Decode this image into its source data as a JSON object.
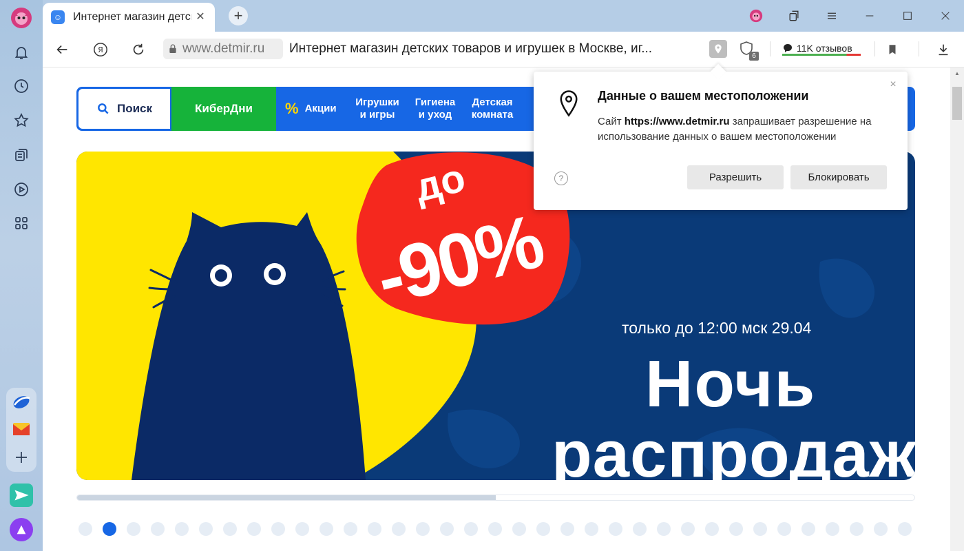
{
  "tab": {
    "title": "Интернет магазин детских товаров и игрушек в Москве, иг...",
    "favicon_icon": "detmir-icon"
  },
  "window": {
    "minimize": "minimize-icon",
    "maximize": "maximize-icon",
    "close": "close-icon"
  },
  "toolbar": {
    "domain": "www.detmir.ru",
    "page_title": "Интернет магазин детских товаров и игрушек в Москве, иг...",
    "reviews_label": "11K отзывов",
    "blocked_count": "6"
  },
  "sidebar": {
    "items": [
      "profile-avatar",
      "notifications-icon",
      "history-icon",
      "bookmarks-icon",
      "collections-icon",
      "video-icon",
      "apps-icon"
    ],
    "bottom": [
      "messenger-icon",
      "mail-icon",
      "add-icon",
      "send-icon",
      "alice-icon"
    ]
  },
  "nav": {
    "search": "Поиск",
    "cyber": "КиберДни",
    "sales": "Акции",
    "toys_1": "Игрушки",
    "toys_2": "и игры",
    "hygiene_1": "Гигиена",
    "hygiene_2": "и уход",
    "room_1": "Детская",
    "room_2": "комната"
  },
  "banner": {
    "do": "до",
    "percent": "-90%",
    "subtitle": "только до 12:00 мск 29.04",
    "title_line1": "Ночь",
    "title_line2": "распродаж"
  },
  "carousel": {
    "progress": 0.5,
    "dot_count": 35,
    "active_dot": 1
  },
  "popup": {
    "title": "Данные о вашем местоположении",
    "text_prefix": "Сайт ",
    "site": "https://www.detmir.ru",
    "text_suffix": " запрашивает разрешение на использование данных о вашем местоположении",
    "allow": "Разрешить",
    "block": "Блокировать",
    "help": "?",
    "close": "×"
  },
  "colors": {
    "brand_blue": "#1767e5",
    "cyber_green": "#16b33a",
    "banner_navy": "#0a3a78",
    "banner_yellow": "#ffe600",
    "banner_red": "#f5281e"
  }
}
